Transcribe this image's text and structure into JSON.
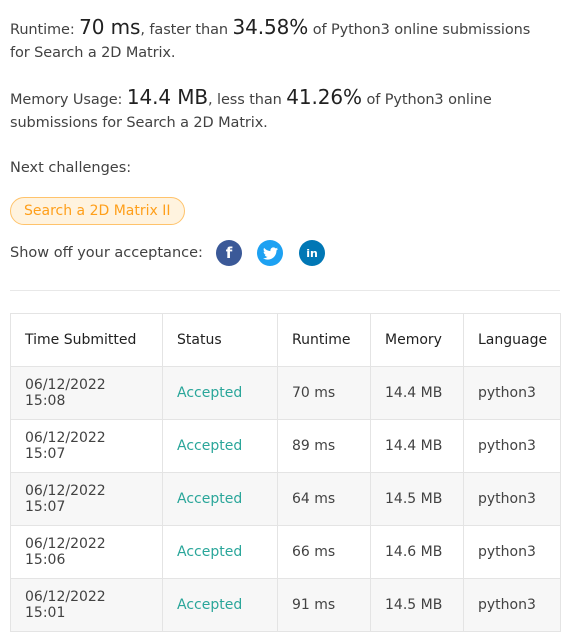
{
  "runtime_stat": {
    "label": "Runtime:",
    "value": "70 ms",
    "mid_text": ", faster than",
    "percent": "34.58%",
    "tail": "of Python3 online submissions for Search a 2D Matrix."
  },
  "memory_stat": {
    "label": "Memory Usage:",
    "value": "14.4 MB",
    "mid_text": ", less than",
    "percent": "41.26%",
    "tail": "of Python3 online submissions for Search a 2D Matrix."
  },
  "next_challenges": {
    "label": "Next challenges:",
    "items": [
      "Search a 2D Matrix II"
    ]
  },
  "share": {
    "label": "Show off your acceptance:",
    "icons": [
      "facebook-icon",
      "twitter-icon",
      "linkedin-icon"
    ]
  },
  "colors": {
    "accepted": "#2aa69a",
    "challenge_tag_text": "#ff9f1a",
    "challenge_tag_bg": "#fff3df",
    "facebook": "#3b5998",
    "twitter": "#1da1f2",
    "linkedin": "#0077b5"
  },
  "submissions": {
    "columns": [
      "Time Submitted",
      "Status",
      "Runtime",
      "Memory",
      "Language"
    ],
    "rows": [
      {
        "time": "06/12/2022 15:08",
        "status": "Accepted",
        "runtime": "70 ms",
        "memory": "14.4 MB",
        "language": "python3"
      },
      {
        "time": "06/12/2022 15:07",
        "status": "Accepted",
        "runtime": "89 ms",
        "memory": "14.4 MB",
        "language": "python3"
      },
      {
        "time": "06/12/2022 15:07",
        "status": "Accepted",
        "runtime": "64 ms",
        "memory": "14.5 MB",
        "language": "python3"
      },
      {
        "time": "06/12/2022 15:06",
        "status": "Accepted",
        "runtime": "66 ms",
        "memory": "14.6 MB",
        "language": "python3"
      },
      {
        "time": "06/12/2022 15:01",
        "status": "Accepted",
        "runtime": "91 ms",
        "memory": "14.5 MB",
        "language": "python3"
      }
    ]
  }
}
